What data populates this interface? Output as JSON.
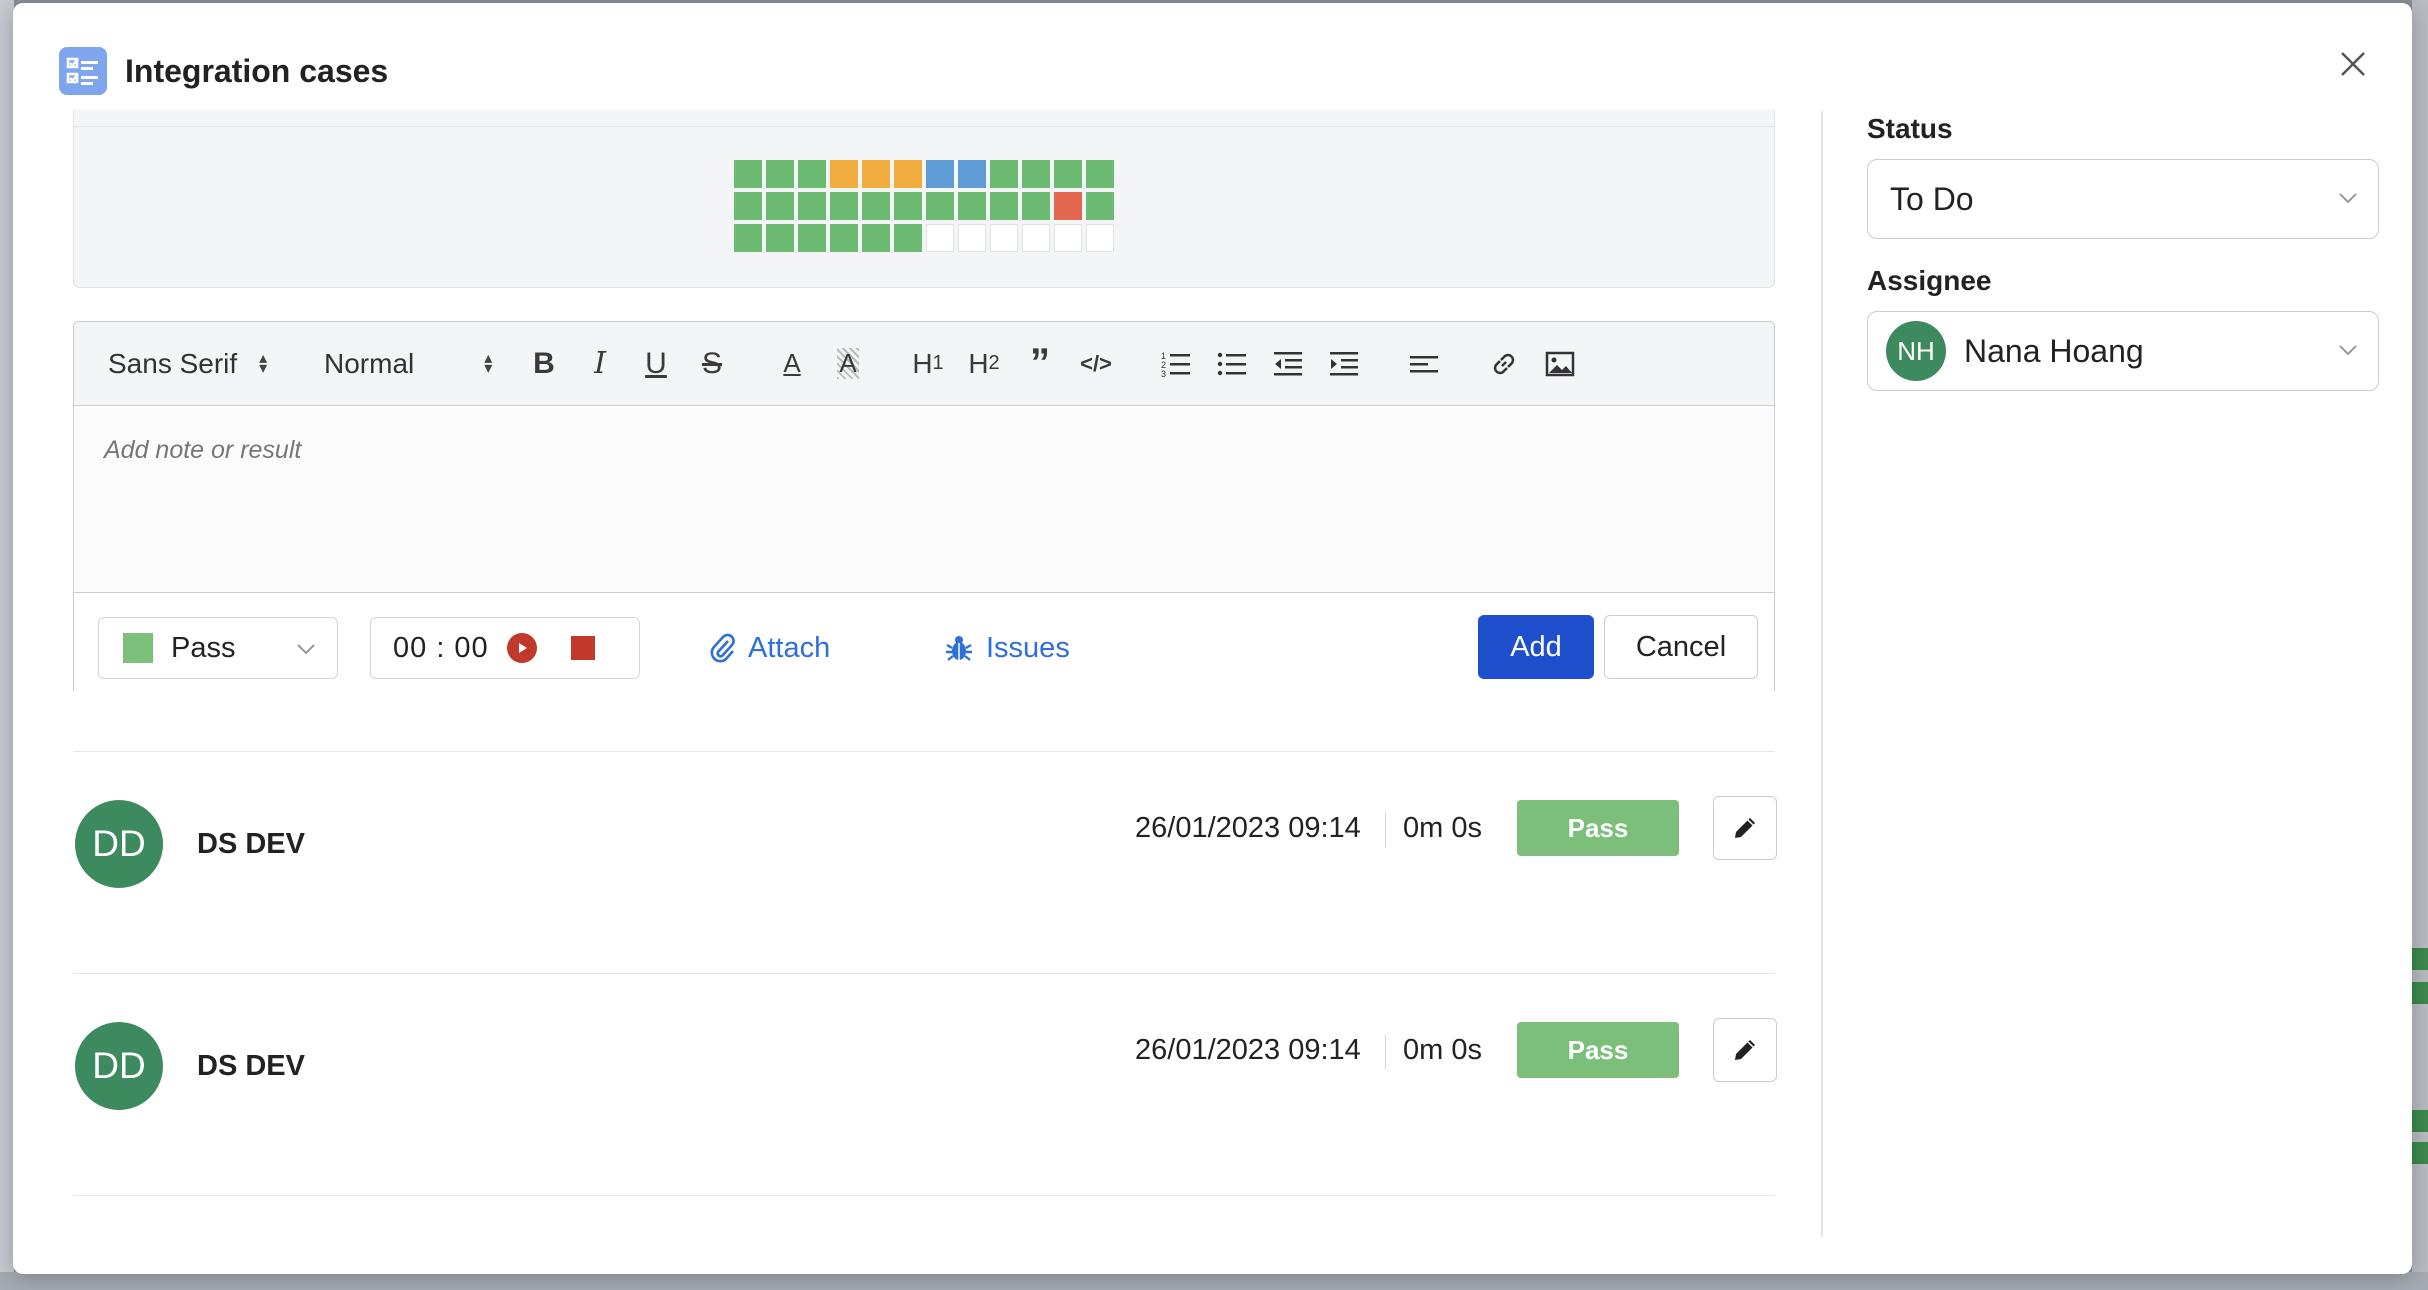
{
  "modal": {
    "title": "Integration cases",
    "icon": "checklist-icon",
    "accent_color": "#7ea5ee"
  },
  "heatmap": {
    "rows": [
      [
        "pass",
        "pass",
        "pass",
        "blocked",
        "blocked",
        "blocked",
        "retest",
        "retest",
        "pass",
        "pass",
        "pass",
        "pass"
      ],
      [
        "pass",
        "pass",
        "pass",
        "pass",
        "pass",
        "pass",
        "pass",
        "pass",
        "pass",
        "pass",
        "fail",
        "pass"
      ],
      [
        "pass",
        "pass",
        "pass",
        "pass",
        "pass",
        "pass",
        "untested",
        "untested",
        "untested",
        "untested",
        "untested",
        "untested"
      ]
    ],
    "colors": {
      "pass": "#6dba73",
      "blocked": "#f0ac3e",
      "retest": "#5f9bd4",
      "fail": "#e4684f",
      "untested": "#ffffff"
    }
  },
  "editor": {
    "font_family_select": "Sans Serif",
    "size_select": "Normal",
    "toolbar_buttons": [
      "bold",
      "italic",
      "underline",
      "strike",
      "text-color",
      "background-color",
      "h1",
      "h2",
      "blockquote",
      "code",
      "ordered-list",
      "bullet-list",
      "outdent",
      "indent",
      "align",
      "link",
      "image"
    ],
    "note_placeholder": "Add note or result"
  },
  "result_form": {
    "status_value": "Pass",
    "status_color": "#7cbf7b",
    "timer_value": "00 : 00",
    "attach_label": "Attach",
    "issues_label": "Issues",
    "add_label": "Add",
    "cancel_label": "Cancel",
    "primary_color": "#1f4fcc",
    "link_color": "#2f6fd8"
  },
  "history": [
    {
      "initials": "DD",
      "author": "DS DEV",
      "timestamp": "26/01/2023 09:14",
      "duration": "0m 0s",
      "result": "Pass"
    },
    {
      "initials": "DD",
      "author": "DS DEV",
      "timestamp": "26/01/2023 09:14",
      "duration": "0m 0s",
      "result": "Pass"
    }
  ],
  "sidebar": {
    "status_label": "Status",
    "status_value": "To Do",
    "assignee_label": "Assignee",
    "assignee_initials": "NH",
    "assignee_name": "Nana Hoang"
  }
}
